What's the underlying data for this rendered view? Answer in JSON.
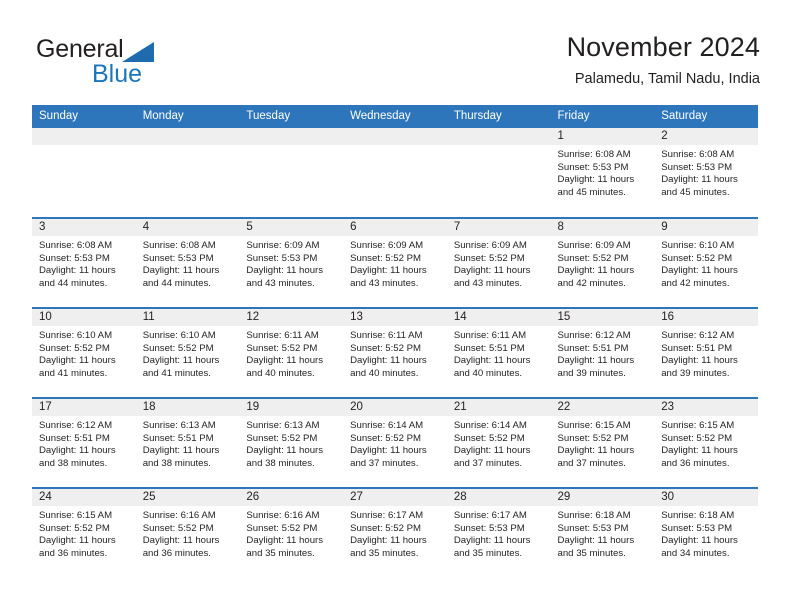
{
  "brand": {
    "name_part1": "General",
    "name_part2": "Blue",
    "triangle_color": "#1e6bb0",
    "blue_color": "#1b75bb"
  },
  "header": {
    "title": "November 2024",
    "subtitle": "Palamedu, Tamil Nadu, India"
  },
  "theme": {
    "header_bg": "#2d76bb",
    "daynum_band_bg": "#efefef",
    "text_color": "#231f20"
  },
  "weekday_headers": [
    "Sunday",
    "Monday",
    "Tuesday",
    "Wednesday",
    "Thursday",
    "Friday",
    "Saturday"
  ],
  "weeks": [
    [
      {
        "day": "",
        "empty": true,
        "sunrise": "",
        "sunset": "",
        "daylight_line1": "",
        "daylight_line2": ""
      },
      {
        "day": "",
        "empty": true,
        "sunrise": "",
        "sunset": "",
        "daylight_line1": "",
        "daylight_line2": ""
      },
      {
        "day": "",
        "empty": true,
        "sunrise": "",
        "sunset": "",
        "daylight_line1": "",
        "daylight_line2": ""
      },
      {
        "day": "",
        "empty": true,
        "sunrise": "",
        "sunset": "",
        "daylight_line1": "",
        "daylight_line2": ""
      },
      {
        "day": "",
        "empty": true,
        "sunrise": "",
        "sunset": "",
        "daylight_line1": "",
        "daylight_line2": ""
      },
      {
        "day": "1",
        "empty": false,
        "sunrise": "Sunrise: 6:08 AM",
        "sunset": "Sunset: 5:53 PM",
        "daylight_line1": "Daylight: 11 hours",
        "daylight_line2": "and 45 minutes."
      },
      {
        "day": "2",
        "empty": false,
        "sunrise": "Sunrise: 6:08 AM",
        "sunset": "Sunset: 5:53 PM",
        "daylight_line1": "Daylight: 11 hours",
        "daylight_line2": "and 45 minutes."
      }
    ],
    [
      {
        "day": "3",
        "empty": false,
        "sunrise": "Sunrise: 6:08 AM",
        "sunset": "Sunset: 5:53 PM",
        "daylight_line1": "Daylight: 11 hours",
        "daylight_line2": "and 44 minutes."
      },
      {
        "day": "4",
        "empty": false,
        "sunrise": "Sunrise: 6:08 AM",
        "sunset": "Sunset: 5:53 PM",
        "daylight_line1": "Daylight: 11 hours",
        "daylight_line2": "and 44 minutes."
      },
      {
        "day": "5",
        "empty": false,
        "sunrise": "Sunrise: 6:09 AM",
        "sunset": "Sunset: 5:53 PM",
        "daylight_line1": "Daylight: 11 hours",
        "daylight_line2": "and 43 minutes."
      },
      {
        "day": "6",
        "empty": false,
        "sunrise": "Sunrise: 6:09 AM",
        "sunset": "Sunset: 5:52 PM",
        "daylight_line1": "Daylight: 11 hours",
        "daylight_line2": "and 43 minutes."
      },
      {
        "day": "7",
        "empty": false,
        "sunrise": "Sunrise: 6:09 AM",
        "sunset": "Sunset: 5:52 PM",
        "daylight_line1": "Daylight: 11 hours",
        "daylight_line2": "and 43 minutes."
      },
      {
        "day": "8",
        "empty": false,
        "sunrise": "Sunrise: 6:09 AM",
        "sunset": "Sunset: 5:52 PM",
        "daylight_line1": "Daylight: 11 hours",
        "daylight_line2": "and 42 minutes."
      },
      {
        "day": "9",
        "empty": false,
        "sunrise": "Sunrise: 6:10 AM",
        "sunset": "Sunset: 5:52 PM",
        "daylight_line1": "Daylight: 11 hours",
        "daylight_line2": "and 42 minutes."
      }
    ],
    [
      {
        "day": "10",
        "empty": false,
        "sunrise": "Sunrise: 6:10 AM",
        "sunset": "Sunset: 5:52 PM",
        "daylight_line1": "Daylight: 11 hours",
        "daylight_line2": "and 41 minutes."
      },
      {
        "day": "11",
        "empty": false,
        "sunrise": "Sunrise: 6:10 AM",
        "sunset": "Sunset: 5:52 PM",
        "daylight_line1": "Daylight: 11 hours",
        "daylight_line2": "and 41 minutes."
      },
      {
        "day": "12",
        "empty": false,
        "sunrise": "Sunrise: 6:11 AM",
        "sunset": "Sunset: 5:52 PM",
        "daylight_line1": "Daylight: 11 hours",
        "daylight_line2": "and 40 minutes."
      },
      {
        "day": "13",
        "empty": false,
        "sunrise": "Sunrise: 6:11 AM",
        "sunset": "Sunset: 5:52 PM",
        "daylight_line1": "Daylight: 11 hours",
        "daylight_line2": "and 40 minutes."
      },
      {
        "day": "14",
        "empty": false,
        "sunrise": "Sunrise: 6:11 AM",
        "sunset": "Sunset: 5:51 PM",
        "daylight_line1": "Daylight: 11 hours",
        "daylight_line2": "and 40 minutes."
      },
      {
        "day": "15",
        "empty": false,
        "sunrise": "Sunrise: 6:12 AM",
        "sunset": "Sunset: 5:51 PM",
        "daylight_line1": "Daylight: 11 hours",
        "daylight_line2": "and 39 minutes."
      },
      {
        "day": "16",
        "empty": false,
        "sunrise": "Sunrise: 6:12 AM",
        "sunset": "Sunset: 5:51 PM",
        "daylight_line1": "Daylight: 11 hours",
        "daylight_line2": "and 39 minutes."
      }
    ],
    [
      {
        "day": "17",
        "empty": false,
        "sunrise": "Sunrise: 6:12 AM",
        "sunset": "Sunset: 5:51 PM",
        "daylight_line1": "Daylight: 11 hours",
        "daylight_line2": "and 38 minutes."
      },
      {
        "day": "18",
        "empty": false,
        "sunrise": "Sunrise: 6:13 AM",
        "sunset": "Sunset: 5:51 PM",
        "daylight_line1": "Daylight: 11 hours",
        "daylight_line2": "and 38 minutes."
      },
      {
        "day": "19",
        "empty": false,
        "sunrise": "Sunrise: 6:13 AM",
        "sunset": "Sunset: 5:52 PM",
        "daylight_line1": "Daylight: 11 hours",
        "daylight_line2": "and 38 minutes."
      },
      {
        "day": "20",
        "empty": false,
        "sunrise": "Sunrise: 6:14 AM",
        "sunset": "Sunset: 5:52 PM",
        "daylight_line1": "Daylight: 11 hours",
        "daylight_line2": "and 37 minutes."
      },
      {
        "day": "21",
        "empty": false,
        "sunrise": "Sunrise: 6:14 AM",
        "sunset": "Sunset: 5:52 PM",
        "daylight_line1": "Daylight: 11 hours",
        "daylight_line2": "and 37 minutes."
      },
      {
        "day": "22",
        "empty": false,
        "sunrise": "Sunrise: 6:15 AM",
        "sunset": "Sunset: 5:52 PM",
        "daylight_line1": "Daylight: 11 hours",
        "daylight_line2": "and 37 minutes."
      },
      {
        "day": "23",
        "empty": false,
        "sunrise": "Sunrise: 6:15 AM",
        "sunset": "Sunset: 5:52 PM",
        "daylight_line1": "Daylight: 11 hours",
        "daylight_line2": "and 36 minutes."
      }
    ],
    [
      {
        "day": "24",
        "empty": false,
        "sunrise": "Sunrise: 6:15 AM",
        "sunset": "Sunset: 5:52 PM",
        "daylight_line1": "Daylight: 11 hours",
        "daylight_line2": "and 36 minutes."
      },
      {
        "day": "25",
        "empty": false,
        "sunrise": "Sunrise: 6:16 AM",
        "sunset": "Sunset: 5:52 PM",
        "daylight_line1": "Daylight: 11 hours",
        "daylight_line2": "and 36 minutes."
      },
      {
        "day": "26",
        "empty": false,
        "sunrise": "Sunrise: 6:16 AM",
        "sunset": "Sunset: 5:52 PM",
        "daylight_line1": "Daylight: 11 hours",
        "daylight_line2": "and 35 minutes."
      },
      {
        "day": "27",
        "empty": false,
        "sunrise": "Sunrise: 6:17 AM",
        "sunset": "Sunset: 5:52 PM",
        "daylight_line1": "Daylight: 11 hours",
        "daylight_line2": "and 35 minutes."
      },
      {
        "day": "28",
        "empty": false,
        "sunrise": "Sunrise: 6:17 AM",
        "sunset": "Sunset: 5:53 PM",
        "daylight_line1": "Daylight: 11 hours",
        "daylight_line2": "and 35 minutes."
      },
      {
        "day": "29",
        "empty": false,
        "sunrise": "Sunrise: 6:18 AM",
        "sunset": "Sunset: 5:53 PM",
        "daylight_line1": "Daylight: 11 hours",
        "daylight_line2": "and 35 minutes."
      },
      {
        "day": "30",
        "empty": false,
        "sunrise": "Sunrise: 6:18 AM",
        "sunset": "Sunset: 5:53 PM",
        "daylight_line1": "Daylight: 11 hours",
        "daylight_line2": "and 34 minutes."
      }
    ]
  ]
}
